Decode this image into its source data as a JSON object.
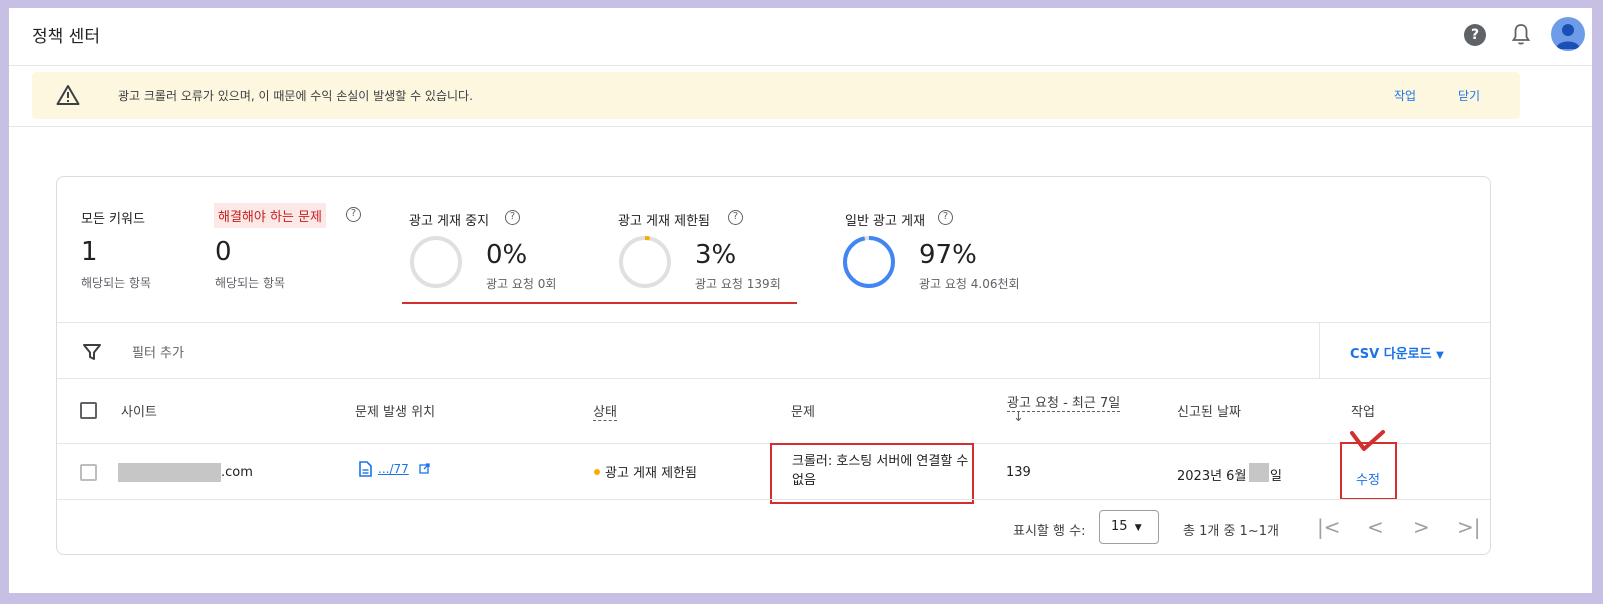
{
  "app": {
    "title": "정책 센터"
  },
  "header": {
    "help_icon": "help-icon",
    "bell_icon": "bell-icon",
    "avatar": "user-avatar",
    "help_glyph": "?"
  },
  "banner": {
    "icon": "warning-icon",
    "message": "광고 크롤러 오류가 있으며, 이 때문에 수익 손실이 발생할 수 있습니다.",
    "action": "작업",
    "close": "닫기"
  },
  "summary": {
    "all_keywords": {
      "label": "모든 키워드",
      "value": "1",
      "sub": "해당되는 항목"
    },
    "issues": {
      "label": "해결해야 하는 문제",
      "value": "0",
      "sub": "해당되는 항목"
    },
    "stopped": {
      "label": "광고 게재 중지",
      "percent": "0%",
      "sub": "광고 요청 0회",
      "fraction": 0
    },
    "limited": {
      "label": "광고 게재 제한됨",
      "percent": "3%",
      "sub": "광고 요청 139회",
      "fraction": 0.03
    },
    "normal": {
      "label": "일반 광고 게재",
      "percent": "97%",
      "sub": "광고 요청 4.06천회",
      "fraction": 0.97
    }
  },
  "toolbar": {
    "filter": "필터 추가",
    "csv": "CSV 다운로드"
  },
  "table": {
    "headers": {
      "site": "사이트",
      "location": "문제 발생 위치",
      "status": "상태",
      "issue": "문제",
      "requests": "광고 요청 - 최근 7일",
      "date": "신고된 날짜",
      "action": "작업"
    },
    "sort_arrow": "↓",
    "rows": [
      {
        "site_suffix": ".com",
        "location": ".../77",
        "status": "광고 게재 제한됨",
        "issue": "크롤러: 호스팅 서버에 연결할 수 없음",
        "requests": "139",
        "date_prefix": "2023년 6월",
        "date_suffix": "일",
        "action": "수정"
      }
    ]
  },
  "footer": {
    "rows_label": "표시할 행 수:",
    "rows_value": "15",
    "range": "총 1개 중 1~1개",
    "first": "|<",
    "prev": "<",
    "next": ">",
    "last": ">|"
  },
  "colors": {
    "accent": "#1a73e8",
    "ring_track": "#e0e0e0",
    "ring_blue": "#4285f4",
    "ring_orange": "#f9ab00",
    "annotation_red": "#d32f2f"
  }
}
